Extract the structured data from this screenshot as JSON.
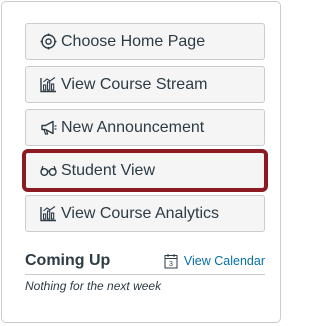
{
  "actions": [
    {
      "label": "Choose Home Page",
      "icon": "target-icon"
    },
    {
      "label": "View Course Stream",
      "icon": "stream-chart-icon"
    },
    {
      "label": "New Announcement",
      "icon": "megaphone-icon"
    },
    {
      "label": "Student View",
      "icon": "glasses-icon"
    },
    {
      "label": "View Course Analytics",
      "icon": "analytics-chart-icon"
    }
  ],
  "coming_up": {
    "title": "Coming Up",
    "calendar_label": "View Calendar",
    "calendar_day": "3",
    "empty_text": "Nothing for the next week"
  },
  "colors": {
    "link": "#0770a3",
    "focus_ring": "#8b1a22",
    "button_bg": "#f5f5f5",
    "text": "#2d3b45"
  }
}
